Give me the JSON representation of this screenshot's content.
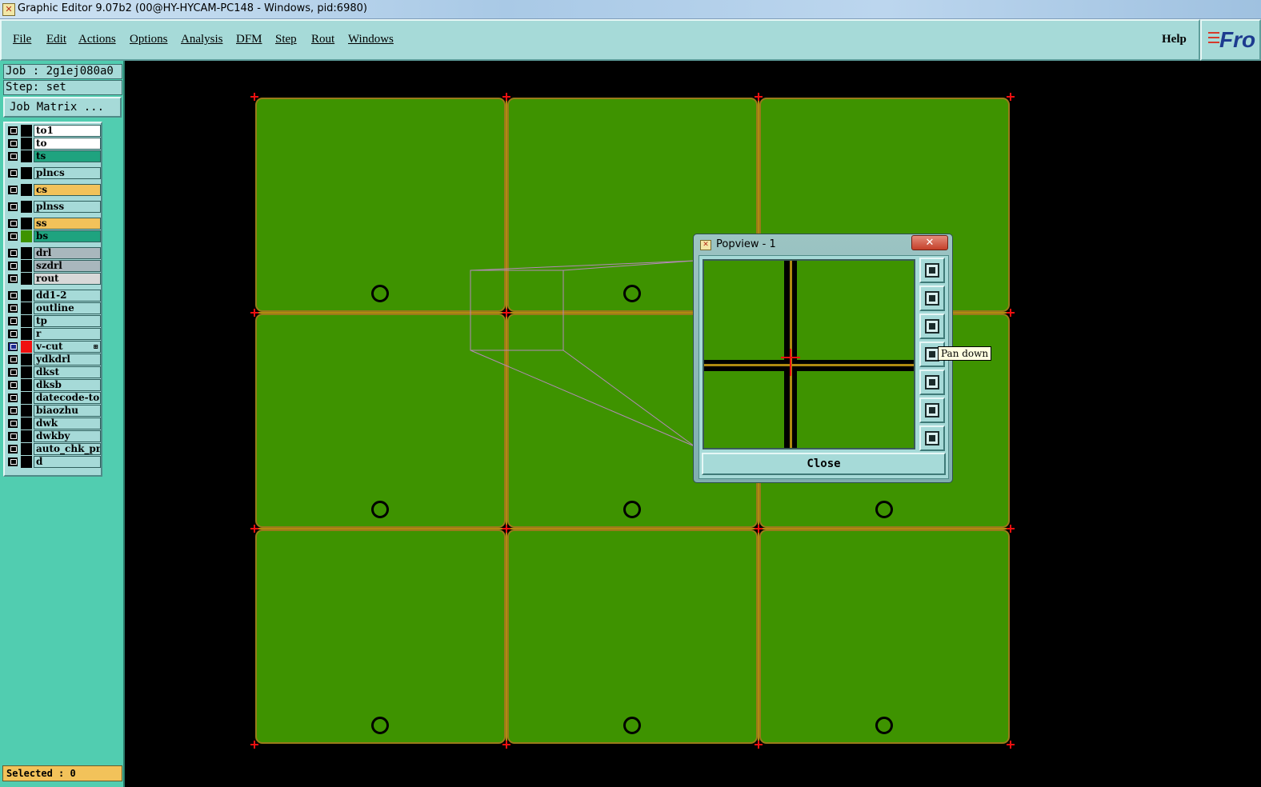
{
  "window": {
    "title": "Graphic Editor 9.07b2 (00@HY-HYCAM-PC148 - Windows, pid:6980)",
    "icon": "app-icon"
  },
  "menu": {
    "items": [
      "File",
      "Edit",
      "Actions",
      "Options",
      "Analysis",
      "DFM",
      "Step",
      "Rout",
      "Windows"
    ],
    "help": "Help"
  },
  "logo": {
    "text": "Fro"
  },
  "left_panel": {
    "job": "Job : 2g1ej080a0",
    "step": "Step: set",
    "job_matrix_label": "Job Matrix ..."
  },
  "layers": [
    {
      "name": "to1",
      "bg": "#ffffff",
      "swatch": "#000000"
    },
    {
      "name": "to",
      "bg": "#ffffff",
      "swatch": "#000000"
    },
    {
      "name": "ts",
      "bg": "#1fa37f",
      "swatch": "#000000"
    },
    {
      "name": "plncs",
      "bg": "#a6dad8",
      "swatch": "#000000"
    },
    {
      "name": "cs",
      "bg": "#f2c25a",
      "swatch": "#000000"
    },
    {
      "name": "plnss",
      "bg": "#a6dad8",
      "swatch": "#000000"
    },
    {
      "name": "ss",
      "bg": "#f2c25a",
      "swatch": "#000000"
    },
    {
      "name": "bs",
      "bg": "#1fa37f",
      "swatch": "#3e9300"
    },
    {
      "name": "drl",
      "bg": "#a9b7bd",
      "swatch": "#000000"
    },
    {
      "name": "szdrl",
      "bg": "#a9b7bd",
      "swatch": "#000000"
    },
    {
      "name": "rout",
      "bg": "#d8d8d8",
      "swatch": "#000000"
    },
    {
      "name": "dd1-2",
      "bg": "#a6dad8",
      "swatch": "#000000"
    },
    {
      "name": "outline",
      "bg": "#a6dad8",
      "swatch": "#000000"
    },
    {
      "name": "tp",
      "bg": "#a6dad8",
      "swatch": "#000000"
    },
    {
      "name": "r",
      "bg": "#a6dad8",
      "swatch": "#000000"
    },
    {
      "name": "v-cut",
      "bg": "#a6dad8",
      "swatch": "#f01010",
      "active": true,
      "extra": "⊞"
    },
    {
      "name": "ydkdrl",
      "bg": "#a6dad8",
      "swatch": "#000000"
    },
    {
      "name": "dkst",
      "bg": "#a6dad8",
      "swatch": "#000000"
    },
    {
      "name": "dksb",
      "bg": "#a6dad8",
      "swatch": "#000000"
    },
    {
      "name": "datecode-to",
      "bg": "#a6dad8",
      "swatch": "#000000"
    },
    {
      "name": "biaozhu",
      "bg": "#a6dad8",
      "swatch": "#000000"
    },
    {
      "name": "dwk",
      "bg": "#a6dad8",
      "swatch": "#000000"
    },
    {
      "name": "dwkby",
      "bg": "#a6dad8",
      "swatch": "#000000"
    },
    {
      "name": "auto_chk_pn",
      "bg": "#a6dad8",
      "swatch": "#000000"
    },
    {
      "name": "d",
      "bg": "#a6dad8",
      "swatch": "#000000"
    }
  ],
  "status": {
    "selected": "Selected : 0"
  },
  "canvas": {
    "board_color": "#3e9300",
    "vcut_color": "#b08a10",
    "mark_color": "#f01010",
    "grid": {
      "rows": 3,
      "cols": 3
    }
  },
  "popview": {
    "title": "Popview - 1",
    "close_x": "✕",
    "close_label": "Close",
    "tools": [
      "zoom-window-icon",
      "pan-up-icon",
      "pan-down-icon",
      "pan-left-icon",
      "pan-right-icon",
      "zoom-in-icon",
      "zoom-out-icon"
    ]
  },
  "tooltip": {
    "text": "Pan down"
  }
}
